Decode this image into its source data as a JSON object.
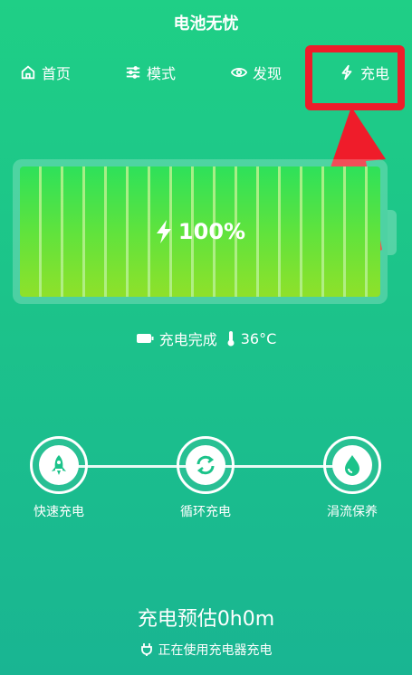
{
  "app": {
    "title": "电池无忧"
  },
  "tabs": [
    {
      "label": "首页",
      "icon": "home-icon"
    },
    {
      "label": "模式",
      "icon": "sliders-icon"
    },
    {
      "label": "发现",
      "icon": "eye-icon"
    },
    {
      "label": "充电",
      "icon": "lightning-icon"
    }
  ],
  "battery": {
    "percent_text": "100%",
    "level": 1.0
  },
  "status": {
    "state": "充电完成",
    "temperature": "36°C"
  },
  "steps": [
    {
      "label": "快速充电",
      "icon": "rocket-icon"
    },
    {
      "label": "循环充电",
      "icon": "cycle-icon"
    },
    {
      "label": "涓流保养",
      "icon": "droplet-icon"
    }
  ],
  "estimate": {
    "text": "充电预估0h0m"
  },
  "footer": {
    "text": "正在使用充电器充电",
    "icon": "plug-icon"
  },
  "colors": {
    "background_top": "#1fcf86",
    "background_bottom": "#19b592",
    "highlight": "#ef1c2a",
    "battery_fill": "#5fe33d"
  }
}
